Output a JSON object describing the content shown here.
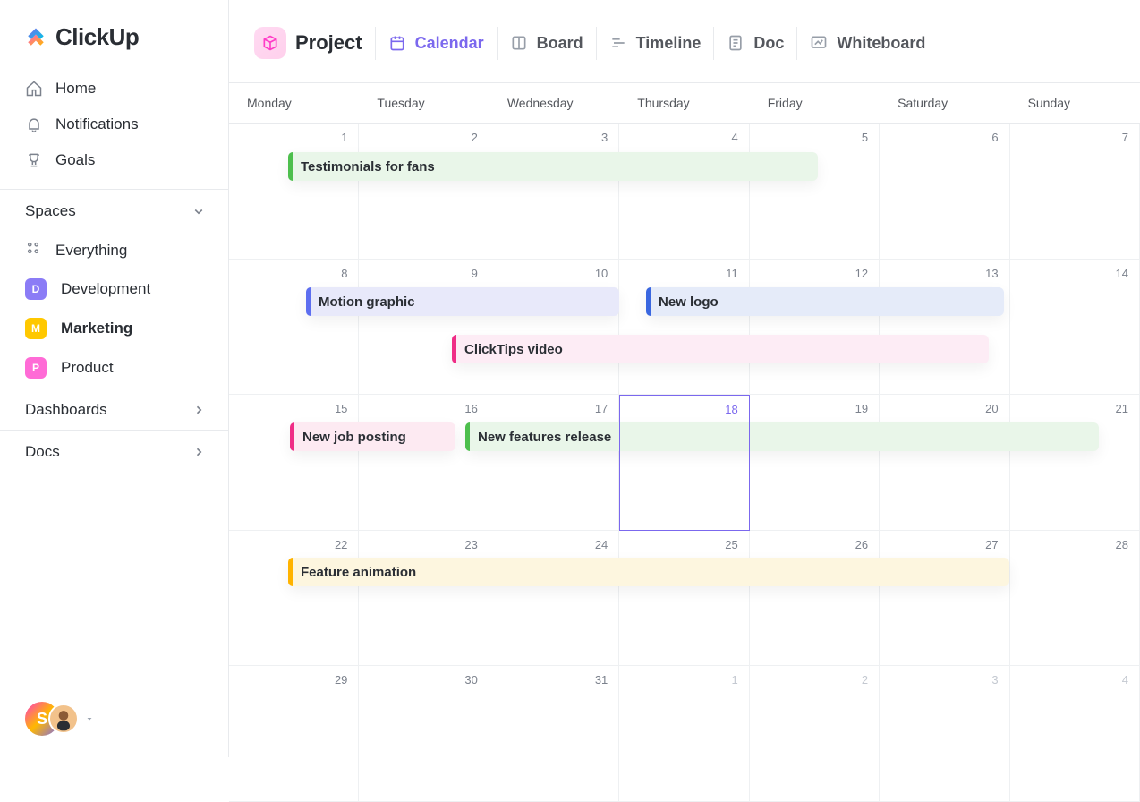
{
  "brand": "ClickUp",
  "nav": {
    "home": "Home",
    "notifications": "Notifications",
    "goals": "Goals"
  },
  "sections": {
    "spaces": "Spaces",
    "dashboards": "Dashboards",
    "docs": "Docs"
  },
  "spaces": {
    "everything": "Everything",
    "dev": {
      "label": "Development",
      "letter": "D",
      "color": "#8b7cf6"
    },
    "mkt": {
      "label": "Marketing",
      "letter": "M",
      "color": "#ffc800"
    },
    "prd": {
      "label": "Product",
      "letter": "P",
      "color": "#ff6bd6"
    }
  },
  "avatar_letter": "S",
  "views": {
    "project": "Project",
    "calendar": "Calendar",
    "board": "Board",
    "timeline": "Timeline",
    "doc": "Doc",
    "whiteboard": "Whiteboard"
  },
  "calendar": {
    "days": [
      "Monday",
      "Tuesday",
      "Wednesday",
      "Thursday",
      "Friday",
      "Saturday",
      "Sunday"
    ],
    "cells": [
      {
        "n": ""
      },
      {
        "n": ""
      },
      {
        "n": ""
      },
      {
        "n": ""
      },
      {
        "n": ""
      },
      {
        "n": ""
      },
      {
        "n": ""
      },
      {
        "n": "1"
      },
      {
        "n": "2"
      },
      {
        "n": "3"
      },
      {
        "n": "4"
      },
      {
        "n": "5"
      },
      {
        "n": "6"
      },
      {
        "n": "7"
      }
    ],
    "row2": [
      "8",
      "9",
      "10",
      "11",
      "12",
      "13",
      "14"
    ],
    "row3": [
      "15",
      "16",
      "17",
      "18",
      "19",
      "20",
      "21"
    ],
    "row4": [
      "22",
      "23",
      "24",
      "25",
      "26",
      "27",
      "28"
    ],
    "row5": [
      "29",
      "30",
      "31",
      "1",
      "2",
      "3",
      "4"
    ],
    "events": {
      "testimonials": "Testimonials for fans",
      "motion": "Motion graphic",
      "newlogo": "New logo",
      "clicktips": "ClickTips video",
      "jobposting": "New job posting",
      "features": "New features release",
      "featureanim": "Feature animation"
    }
  },
  "colors": {
    "purple": "#7b68ee",
    "green_bg": "#e9f6e9",
    "green_bar": "#4dbf4d",
    "lav_bg": "#e8e9fa",
    "lav_bar": "#5d6ef0",
    "blue_bg": "#e5ebf9",
    "blue_bar": "#3a67e0",
    "pink_bg": "#fdecf5",
    "pink_bar": "#ef2d86",
    "pink2_bg": "#fdeaf2",
    "pink2_bar": "#ef2d86",
    "green2_bg": "#e9f6e9",
    "green2_bar": "#4dbf4d",
    "yellow_bg": "#fdf6df",
    "yellow_bar": "#ffb300"
  }
}
